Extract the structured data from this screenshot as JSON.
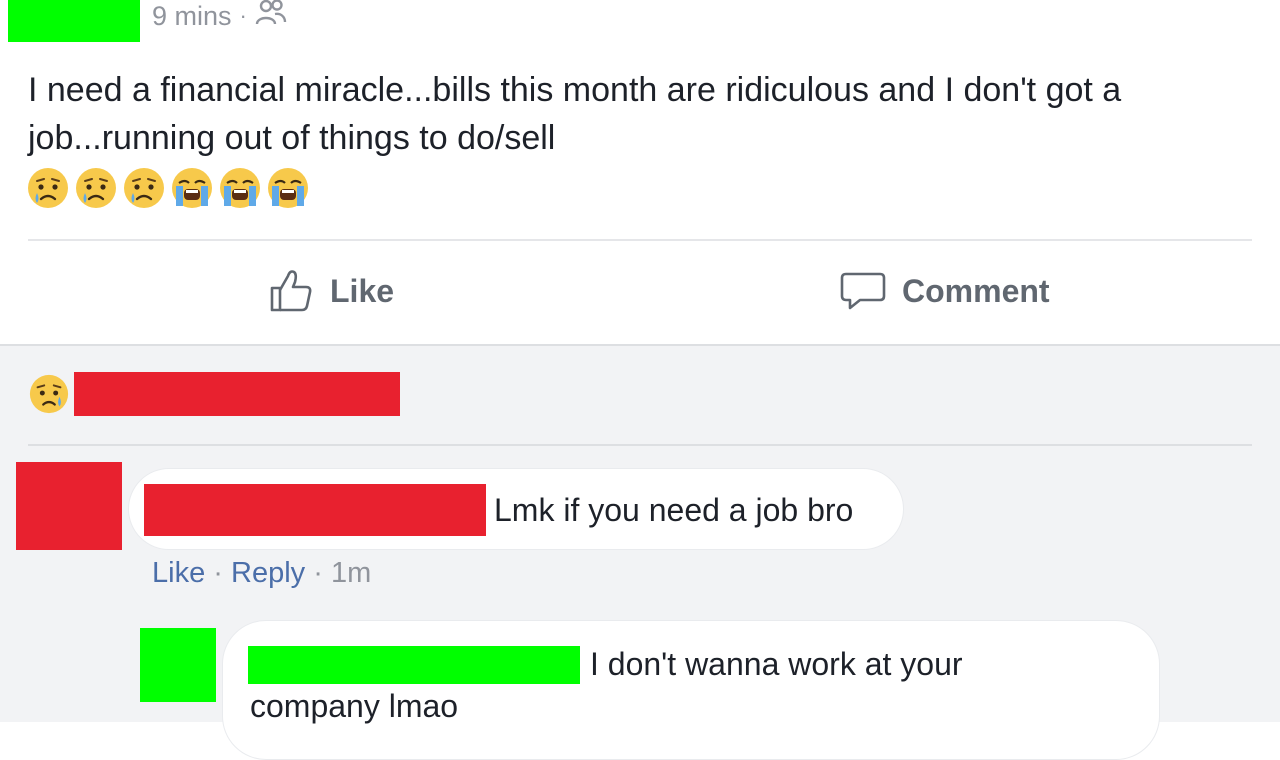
{
  "colors": {
    "redact_green": "#00ff00",
    "redact_red": "#e8212f",
    "link_blue": "#4b6ea9",
    "meta_gray": "#90949c"
  },
  "post": {
    "time": "9 mins",
    "separator": "·",
    "audience_icon": "friends-icon",
    "text": "I need a financial miracle...bills this month are ridiculous and I don't got a job...running out of things to do/sell",
    "emojis": [
      "sad-tear-emoji",
      "sad-tear-emoji",
      "sad-tear-emoji",
      "loudly-crying-emoji",
      "loudly-crying-emoji",
      "loudly-crying-emoji"
    ]
  },
  "actions": {
    "like_label": "Like",
    "comment_label": "Comment"
  },
  "reactions": {
    "icon": "sad-reaction-icon"
  },
  "comments": [
    {
      "text": "Lmk if you need a job bro",
      "like_label": "Like",
      "separator": "·",
      "reply_label": "Reply",
      "time": "1m"
    },
    {
      "text_line1": "I don't wanna work at your",
      "text_line2": "company lmao"
    }
  ]
}
